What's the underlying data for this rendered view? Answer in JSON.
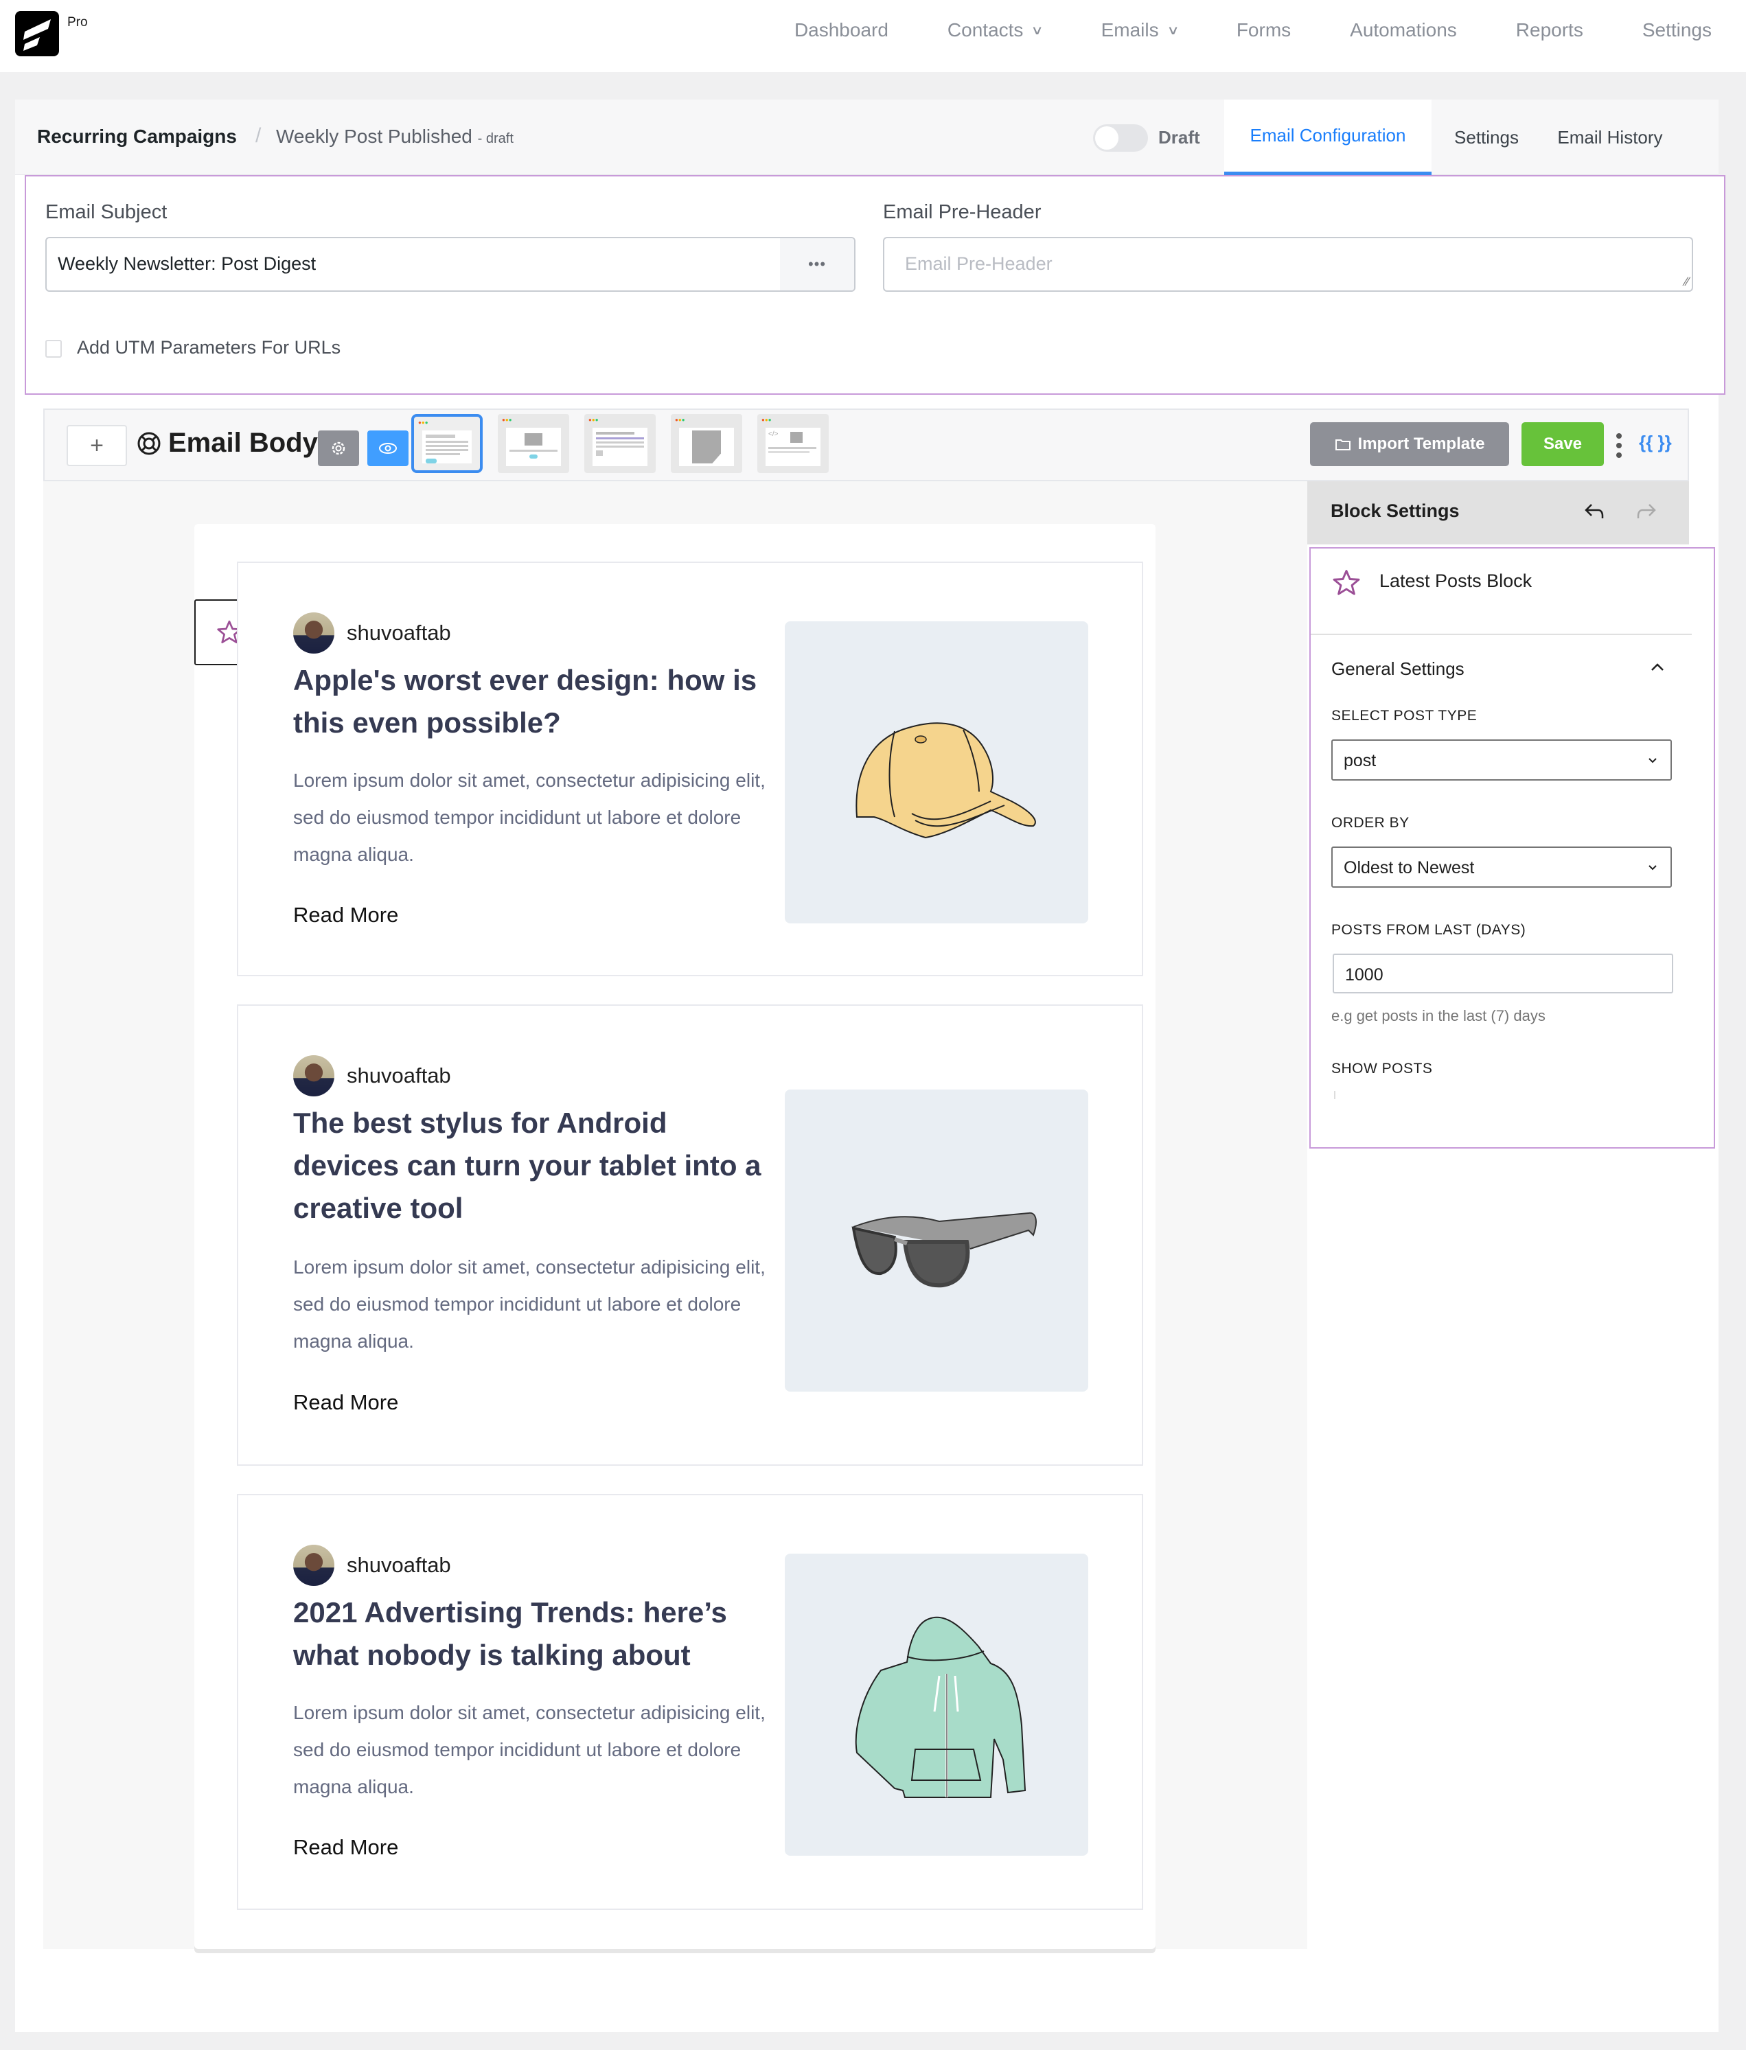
{
  "app": {
    "logo_badge": "Pro",
    "nav": [
      {
        "label": "Dashboard",
        "has_dropdown": false
      },
      {
        "label": "Contacts",
        "has_dropdown": true
      },
      {
        "label": "Emails",
        "has_dropdown": true
      },
      {
        "label": "Forms",
        "has_dropdown": false
      },
      {
        "label": "Automations",
        "has_dropdown": false
      },
      {
        "label": "Reports",
        "has_dropdown": false
      },
      {
        "label": "Settings",
        "has_dropdown": false
      }
    ]
  },
  "breadcrumb": {
    "root": "Recurring Campaigns",
    "separator": "/",
    "current": "Weekly Post Published",
    "status": "- draft"
  },
  "status_toggle": {
    "label": "Draft",
    "on": false
  },
  "tabs": [
    {
      "label": "Email Configuration",
      "active": true
    },
    {
      "label": "Settings",
      "active": false
    },
    {
      "label": "Email History",
      "active": false
    }
  ],
  "config": {
    "subject_label": "Email Subject",
    "subject_value": "Weekly Newsletter: Post Digest",
    "subject_more": "•••",
    "preheader_label": "Email Pre-Header",
    "preheader_placeholder": "Email Pre-Header",
    "preheader_value": "",
    "utm_label": "Add UTM Parameters For URLs",
    "utm_checked": false
  },
  "editor": {
    "add_label": "+",
    "title": "Email Body",
    "templates": [
      "Simple text",
      "Image hero",
      "Newsletter list",
      "Plain note",
      "Raw HTML"
    ],
    "selected_template": 0,
    "import_label": "Import Template",
    "save_label": "Save",
    "shortcode_label": "{{ }}",
    "accent": "#3b8cf0",
    "save_color": "#67c23a"
  },
  "posts": [
    {
      "author": "shuvoaftab",
      "title": "Apple's worst ever design: how is this even possible?",
      "excerpt": "Lorem ipsum dolor sit amet, consectetur adipisicing elit, sed do eiusmod tempor incididunt ut labore et dolore magna aliqua.",
      "read_more": "Read More",
      "image": "cap-illustration"
    },
    {
      "author": "shuvoaftab",
      "title": "The best stylus for Android devices can turn your tablet into a creative tool",
      "excerpt": "Lorem ipsum dolor sit amet, consectetur adipisicing elit, sed do eiusmod tempor incididunt ut labore et dolore magna aliqua.",
      "read_more": "Read More",
      "image": "sunglasses-illustration"
    },
    {
      "author": "shuvoaftab",
      "title": "2021 Advertising Trends: here’s what nobody is talking about",
      "excerpt": "Lorem ipsum dolor sit amet, consectetur adipisicing elit, sed do eiusmod tempor incididunt ut labore et dolore magna aliqua.",
      "read_more": "Read More",
      "image": "hoodie-illustration"
    }
  ],
  "block_settings": {
    "title": "Block Settings",
    "block_name": "Latest Posts Block",
    "section_title": "General Settings",
    "section_expanded": true,
    "post_type_label": "SELECT POST TYPE",
    "post_type_value": "post",
    "order_label": "ORDER BY",
    "order_value": "Oldest to Newest",
    "days_label": "POSTS FROM LAST (DAYS)",
    "days_value": "1000",
    "days_hint": "e.g get posts in the last (7) days",
    "show_posts_label": "SHOW POSTS"
  }
}
